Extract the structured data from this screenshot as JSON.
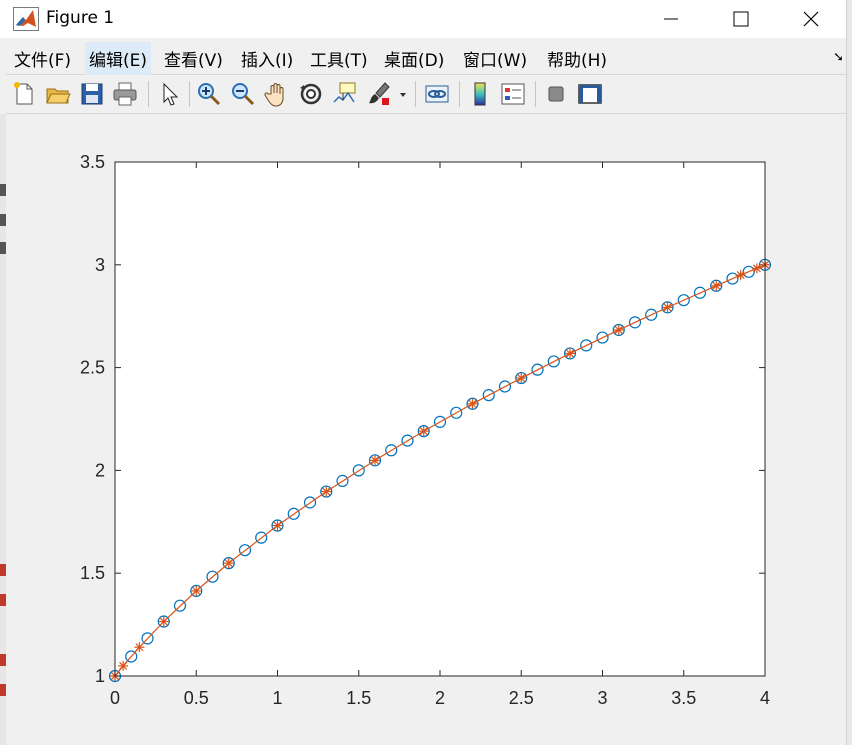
{
  "window": {
    "title": "Figure 1",
    "minimize_glyph": "—",
    "maximize_glyph": "☐",
    "close_glyph": "✕"
  },
  "menu": {
    "items": [
      "文件(F)",
      "编辑(E)",
      "查看(V)",
      "插入(I)",
      "工具(T)",
      "桌面(D)",
      "窗口(W)",
      "帮助(H)"
    ],
    "active_index": 1
  },
  "toolbar": {
    "buttons": [
      "new-figure-icon",
      "open-file-icon",
      "save-icon",
      "print-icon",
      "pointer-icon",
      "zoom-in-icon",
      "zoom-out-icon",
      "pan-hand-icon",
      "rotate-3d-icon",
      "data-cursor-icon",
      "brush-icon",
      "link-plot-icon",
      "colorbar-icon",
      "legend-icon",
      "hide-plot-tools-icon",
      "show-plot-tools-icon"
    ]
  },
  "colors": {
    "series_circles": "#0072bd",
    "series_stars": "#d95319",
    "axes": "#262626",
    "background": "#f0f0f0",
    "plot_area": "#ffffff"
  },
  "chart_data": {
    "type": "line",
    "title": "",
    "xlabel": "",
    "ylabel": "",
    "xlim": [
      0,
      4
    ],
    "ylim": [
      1,
      3.5
    ],
    "xticks": [
      0,
      0.5,
      1,
      1.5,
      2,
      2.5,
      3,
      3.5,
      4
    ],
    "yticks": [
      1,
      1.5,
      2,
      2.5,
      3,
      3.5
    ],
    "xtick_labels": [
      "0",
      "0.5",
      "1",
      "1.5",
      "2",
      "2.5",
      "3",
      "3.5",
      "4"
    ],
    "ytick_labels": [
      "1",
      "1.5",
      "2",
      "2.5",
      "3",
      "3.5"
    ],
    "grid": false,
    "legend": "none",
    "series": [
      {
        "marker": "o",
        "linestyle": "none",
        "x": [
          0,
          0.1,
          0.2,
          0.3,
          0.4,
          0.5,
          0.6,
          0.7,
          0.8,
          0.9,
          1.0,
          1.1,
          1.2,
          1.3,
          1.4,
          1.5,
          1.6,
          1.7,
          1.8,
          1.9,
          2.0,
          2.1,
          2.2,
          2.3,
          2.4,
          2.5,
          2.6,
          2.7,
          2.8,
          2.9,
          3.0,
          3.1,
          3.2,
          3.3,
          3.4,
          3.5,
          3.6,
          3.7,
          3.8,
          3.9,
          4.0
        ],
        "y": [
          1.0,
          1.095,
          1.183,
          1.265,
          1.342,
          1.414,
          1.483,
          1.549,
          1.612,
          1.673,
          1.732,
          1.789,
          1.844,
          1.897,
          1.949,
          2.0,
          2.049,
          2.098,
          2.145,
          2.191,
          2.236,
          2.28,
          2.324,
          2.366,
          2.408,
          2.449,
          2.49,
          2.53,
          2.569,
          2.608,
          2.646,
          2.683,
          2.72,
          2.757,
          2.793,
          2.828,
          2.864,
          2.898,
          2.933,
          2.966,
          3.0
        ]
      },
      {
        "marker": "*",
        "linestyle": "solid",
        "x": [
          0,
          0.05,
          0.15,
          0.3,
          0.5,
          0.7,
          1.0,
          1.3,
          1.6,
          1.9,
          2.2,
          2.5,
          2.8,
          3.1,
          3.4,
          3.7,
          3.85,
          3.95,
          4.0
        ],
        "y": [
          1.0,
          1.049,
          1.14,
          1.265,
          1.414,
          1.549,
          1.732,
          1.897,
          2.049,
          2.191,
          2.324,
          2.449,
          2.569,
          2.683,
          2.793,
          2.898,
          2.95,
          2.983,
          3.0
        ]
      }
    ]
  }
}
